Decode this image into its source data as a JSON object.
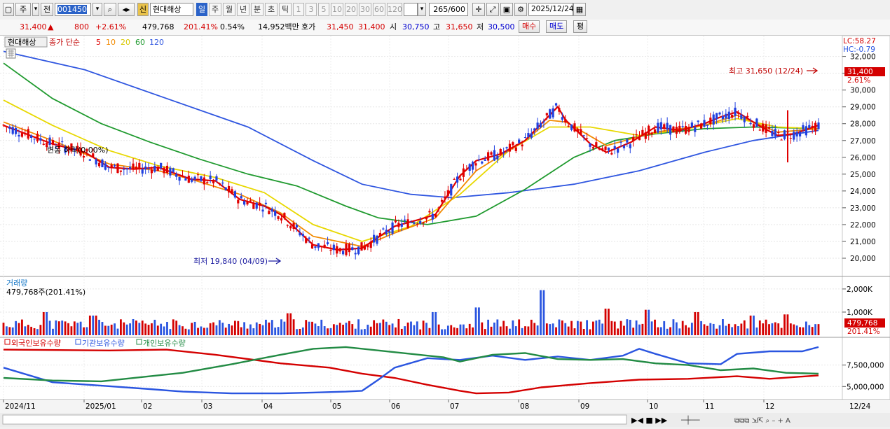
{
  "toolbar": {
    "prefix_1": "주",
    "prefix_2": "전",
    "stock_code": "001450",
    "market_badge": "신",
    "stock_name": "현대해상",
    "period_active": "일",
    "periods": [
      "주",
      "월",
      "년",
      "분",
      "초",
      "틱"
    ],
    "ranges": [
      "1",
      "3",
      "5",
      "10",
      "20",
      "30",
      "60",
      "120"
    ],
    "count_display": "265",
    "count_total": "/600",
    "date": "2025/12/24"
  },
  "quote": {
    "price": "31,400",
    "change": "800",
    "change_pct": "+2.61%",
    "volume": "479,768",
    "volume_ratio": "201.41%",
    "turnover_rate": "0.54%",
    "amount": "14,952백만",
    "bid_label": "호가",
    "ask_price": "31,450",
    "bid_price": "31,400",
    "open_label": "시",
    "open": "30,750",
    "high_label": "고",
    "high": "31,650",
    "low_label": "저",
    "low": "30,500",
    "buy_label": "매수",
    "sell_label": "매도",
    "eval_label": "평"
  },
  "legend": {
    "name": "현대해상",
    "ma_prefix": "종가 단순",
    "ma_periods": [
      "5",
      "10",
      "20",
      "60",
      "120"
    ],
    "ma_colors": [
      "#e00000",
      "#f28a00",
      "#e8d800",
      "#1f9a2e",
      "#2f56e0"
    ]
  },
  "price_panel": {
    "lc": "LC:58.27",
    "hc": "HC:-0.79",
    "price_tag": "31,400",
    "pct_tag": "2.61%",
    "high_annotation": "최고 31,650 (12/24)",
    "low_annotation": "최저 19,840 (04/09)",
    "fall_annotation": "변동 하락(0.00%)"
  },
  "volume_panel": {
    "title": "거래량",
    "value_text": "479,768주(201.41%)",
    "tag": "479,768",
    "tag_pct": "201.41%"
  },
  "holdings_panel": {
    "series_names": [
      "외국인보유수량",
      "기관보유수량",
      "개인보유수량"
    ],
    "colors": [
      "#d40000",
      "#2a55e0",
      "#228b44"
    ]
  },
  "x_axis": {
    "labels": [
      "2024/11",
      "2025/01",
      "02",
      "03",
      "04",
      "05",
      "06",
      "07",
      "08",
      "09",
      "10",
      "11",
      "12"
    ],
    "last_label": "12/24"
  },
  "chart_data": [
    {
      "type": "candlestick",
      "title": "현대해상",
      "y_ticks": [
        "32,000",
        "31,000",
        "30,000",
        "29,000",
        "28,000",
        "27,000",
        "26,000",
        "25,000",
        "24,000",
        "23,000",
        "22,000",
        "21,000",
        "20,000"
      ],
      "ylim": [
        19500,
        32400
      ],
      "series": [
        {
          "name": "5",
          "color": "#e00000",
          "points": [
            [
              0,
              27900
            ],
            [
              0.06,
              26800
            ],
            [
              0.1,
              26300
            ],
            [
              0.13,
              25400
            ],
            [
              0.16,
              25300
            ],
            [
              0.19,
              25400
            ],
            [
              0.23,
              24700
            ],
            [
              0.26,
              24600
            ],
            [
              0.29,
              23500
            ],
            [
              0.32,
              23100
            ],
            [
              0.34,
              22600
            ],
            [
              0.38,
              20800
            ],
            [
              0.41,
              20500
            ],
            [
              0.44,
              20600
            ],
            [
              0.48,
              21900
            ],
            [
              0.51,
              22300
            ],
            [
              0.53,
              22600
            ],
            [
              0.56,
              24900
            ],
            [
              0.58,
              25800
            ],
            [
              0.61,
              26200
            ],
            [
              0.64,
              27000
            ],
            [
              0.67,
              28500
            ],
            [
              0.68,
              29000
            ],
            [
              0.69,
              28200
            ],
            [
              0.72,
              26800
            ],
            [
              0.74,
              26300
            ],
            [
              0.77,
              26900
            ],
            [
              0.8,
              27800
            ],
            [
              0.83,
              27600
            ],
            [
              0.86,
              28000
            ],
            [
              0.88,
              28400
            ],
            [
              0.9,
              28700
            ],
            [
              0.93,
              27800
            ],
            [
              0.95,
              27300
            ],
            [
              0.97,
              27400
            ],
            [
              1.0,
              27900
            ]
          ]
        },
        {
          "name": "10",
          "color": "#f28a00",
          "points": [
            [
              0,
              28100
            ],
            [
              0.06,
              27000
            ],
            [
              0.13,
              25600
            ],
            [
              0.19,
              25200
            ],
            [
              0.23,
              24700
            ],
            [
              0.29,
              23800
            ],
            [
              0.34,
              22700
            ],
            [
              0.38,
              21300
            ],
            [
              0.44,
              20700
            ],
            [
              0.48,
              21500
            ],
            [
              0.53,
              22400
            ],
            [
              0.58,
              25200
            ],
            [
              0.64,
              27000
            ],
            [
              0.67,
              28200
            ],
            [
              0.69,
              28100
            ],
            [
              0.74,
              26700
            ],
            [
              0.8,
              27500
            ],
            [
              0.86,
              27900
            ],
            [
              0.9,
              28500
            ],
            [
              0.95,
              27500
            ],
            [
              1.0,
              27700
            ]
          ]
        },
        {
          "name": "20",
          "color": "#e8d800",
          "points": [
            [
              0,
              29400
            ],
            [
              0.06,
              27900
            ],
            [
              0.13,
              26400
            ],
            [
              0.19,
              25500
            ],
            [
              0.26,
              24800
            ],
            [
              0.32,
              23900
            ],
            [
              0.38,
              22000
            ],
            [
              0.44,
              21000
            ],
            [
              0.5,
              21900
            ],
            [
              0.56,
              23800
            ],
            [
              0.62,
              26400
            ],
            [
              0.67,
              27800
            ],
            [
              0.72,
              27800
            ],
            [
              0.78,
              27300
            ],
            [
              0.84,
              27700
            ],
            [
              0.9,
              28300
            ],
            [
              0.95,
              27800
            ],
            [
              1.0,
              27700
            ]
          ]
        },
        {
          "name": "60",
          "color": "#1f9a2e",
          "points": [
            [
              0,
              31600
            ],
            [
              0.06,
              29500
            ],
            [
              0.12,
              28000
            ],
            [
              0.18,
              26900
            ],
            [
              0.24,
              25900
            ],
            [
              0.3,
              25000
            ],
            [
              0.36,
              24300
            ],
            [
              0.42,
              23100
            ],
            [
              0.46,
              22400
            ],
            [
              0.52,
              22000
            ],
            [
              0.58,
              22500
            ],
            [
              0.64,
              24100
            ],
            [
              0.7,
              26000
            ],
            [
              0.75,
              27000
            ],
            [
              0.8,
              27400
            ],
            [
              0.86,
              27700
            ],
            [
              0.92,
              27800
            ],
            [
              1.0,
              27700
            ]
          ]
        },
        {
          "name": "120",
          "color": "#2f56e0",
          "points": [
            [
              0,
              32300
            ],
            [
              0.1,
              31200
            ],
            [
              0.2,
              29500
            ],
            [
              0.3,
              27800
            ],
            [
              0.38,
              25800
            ],
            [
              0.44,
              24400
            ],
            [
              0.5,
              23800
            ],
            [
              0.55,
              23600
            ],
            [
              0.62,
              23900
            ],
            [
              0.7,
              24400
            ],
            [
              0.78,
              25200
            ],
            [
              0.86,
              26300
            ],
            [
              0.92,
              27000
            ],
            [
              1.0,
              27600
            ]
          ]
        }
      ]
    },
    {
      "type": "bar",
      "title": "거래량",
      "y_ticks": [
        "2,000K",
        "1,000K"
      ],
      "ylim": [
        0,
        2300
      ],
      "unit": "K"
    },
    {
      "type": "line",
      "title": "보유수량",
      "y_ticks": [
        "7,500,000",
        "5,000,000"
      ],
      "series": [
        {
          "name": "외국인보유수량",
          "color": "#d40000",
          "points": [
            [
              0,
              9300
            ],
            [
              0.13,
              9200
            ],
            [
              0.2,
              9300
            ],
            [
              0.26,
              8700
            ],
            [
              0.34,
              7700
            ],
            [
              0.4,
              7200
            ],
            [
              0.44,
              6500
            ],
            [
              0.48,
              6000
            ],
            [
              0.52,
              5200
            ],
            [
              0.56,
              4500
            ],
            [
              0.58,
              4200
            ],
            [
              0.62,
              4300
            ],
            [
              0.66,
              4900
            ],
            [
              0.72,
              5400
            ],
            [
              0.78,
              5800
            ],
            [
              0.84,
              5900
            ],
            [
              0.9,
              6200
            ],
            [
              0.94,
              5900
            ],
            [
              1.0,
              6300
            ]
          ]
        },
        {
          "name": "기관보유수량",
          "color": "#2a55e0",
          "points": [
            [
              0,
              7200
            ],
            [
              0.06,
              5500
            ],
            [
              0.12,
              5100
            ],
            [
              0.18,
              4700
            ],
            [
              0.22,
              4400
            ],
            [
              0.28,
              4200
            ],
            [
              0.34,
              4200
            ],
            [
              0.38,
              4300
            ],
            [
              0.42,
              4400
            ],
            [
              0.44,
              4500
            ],
            [
              0.46,
              5800
            ],
            [
              0.48,
              7200
            ],
            [
              0.52,
              8300
            ],
            [
              0.54,
              8200
            ],
            [
              0.56,
              8100
            ],
            [
              0.6,
              8600
            ],
            [
              0.64,
              8100
            ],
            [
              0.68,
              8500
            ],
            [
              0.72,
              8100
            ],
            [
              0.76,
              8600
            ],
            [
              0.78,
              9400
            ],
            [
              0.8,
              8800
            ],
            [
              0.84,
              7700
            ],
            [
              0.88,
              7600
            ],
            [
              0.9,
              8800
            ],
            [
              0.94,
              9100
            ],
            [
              0.98,
              9100
            ],
            [
              1.0,
              9600
            ]
          ]
        },
        {
          "name": "개인보유수량",
          "color": "#228b44",
          "points": [
            [
              0,
              6000
            ],
            [
              0.06,
              5700
            ],
            [
              0.12,
              5600
            ],
            [
              0.18,
              6200
            ],
            [
              0.22,
              6600
            ],
            [
              0.28,
              7600
            ],
            [
              0.34,
              8700
            ],
            [
              0.38,
              9400
            ],
            [
              0.42,
              9600
            ],
            [
              0.46,
              9200
            ],
            [
              0.5,
              8800
            ],
            [
              0.54,
              8400
            ],
            [
              0.56,
              7900
            ],
            [
              0.6,
              8700
            ],
            [
              0.64,
              8900
            ],
            [
              0.68,
              8200
            ],
            [
              0.72,
              8100
            ],
            [
              0.76,
              8200
            ],
            [
              0.8,
              7700
            ],
            [
              0.84,
              7500
            ],
            [
              0.88,
              6900
            ],
            [
              0.92,
              7100
            ],
            [
              0.96,
              6600
            ],
            [
              1.0,
              6500
            ]
          ]
        }
      ]
    }
  ]
}
